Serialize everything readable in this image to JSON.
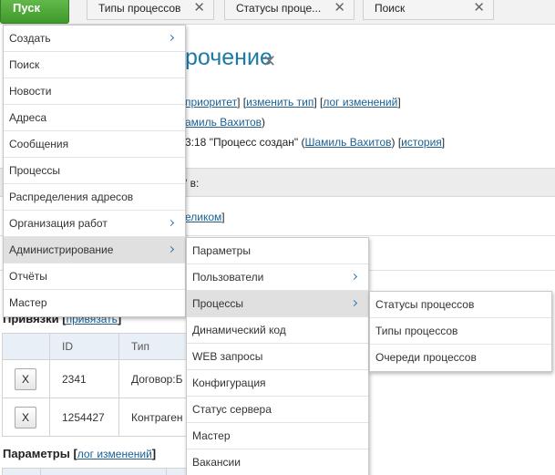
{
  "topbar": {
    "start_label": "Пуск",
    "tabs": [
      {
        "label": "Типы процессов",
        "close": "✕"
      },
      {
        "label": "Статусы проце...",
        "close": "✕"
      },
      {
        "label": "Поиск",
        "close": "✕"
      }
    ]
  },
  "page": {
    "title": "рочение",
    "title_close": "✕",
    "line1": {
      "prefix": "",
      "l1": "приоритет",
      "mid": "] [",
      "l2": "изменить тип",
      "mid2": "] [",
      "l3": "лог изменений",
      "suffix": "]"
    },
    "line2": {
      "link": "амиль Вахитов",
      "suffix": ")"
    },
    "line3": {
      "prefix": "3:18 \"Процесс создан\" (",
      "link": "Шамиль Вахитов",
      "mid": ") [",
      "link2": "история",
      "suffix": "]"
    },
    "bar_text": "\" в:",
    "line4": {
      "link": "еликом",
      "suffix": "]"
    },
    "bindings": {
      "title": "Привязки",
      "link": "привязать",
      "columns": [
        "",
        "ID",
        "Тип"
      ],
      "rows": [
        {
          "button": "X",
          "id": "2341",
          "type": "Договор:Б"
        },
        {
          "button": "X",
          "id": "1254427",
          "type": "Контраген"
        }
      ]
    },
    "params": {
      "title": "Параметры",
      "link": "лог изменений"
    }
  },
  "menu_main": {
    "items": [
      {
        "label": "Создать",
        "submenu": true
      },
      {
        "label": "Поиск",
        "submenu": false
      },
      {
        "label": "Новости",
        "submenu": false
      },
      {
        "label": "Адреса",
        "submenu": false
      },
      {
        "label": "Сообщения",
        "submenu": false
      },
      {
        "label": "Процессы",
        "submenu": false
      },
      {
        "label": "Распределения адресов",
        "submenu": false
      },
      {
        "label": "Организация работ",
        "submenu": true
      },
      {
        "label": "Администрирование",
        "submenu": true,
        "active": true
      },
      {
        "label": "Отчёты",
        "submenu": false
      },
      {
        "label": "Мастер",
        "submenu": false
      }
    ]
  },
  "menu_admin": {
    "items": [
      {
        "label": "Параметры",
        "submenu": false
      },
      {
        "label": "Пользователи",
        "submenu": true
      },
      {
        "label": "Процессы",
        "submenu": true,
        "active": true
      },
      {
        "label": "Динамический код",
        "submenu": false
      },
      {
        "label": "WEB запросы",
        "submenu": false
      },
      {
        "label": "Конфигурация",
        "submenu": false
      },
      {
        "label": "Статус сервера",
        "submenu": false
      },
      {
        "label": "Мастер",
        "submenu": false
      },
      {
        "label": "Вакансии",
        "submenu": false
      }
    ]
  },
  "menu_processes": {
    "items": [
      {
        "label": "Статусы процессов"
      },
      {
        "label": "Типы процессов"
      },
      {
        "label": "Очереди процессов"
      }
    ]
  },
  "colors": {
    "start_button": "#4caa35",
    "link": "#1b5e8f",
    "title": "#1b7aa8",
    "chevron": "#2d77b5",
    "active_item": "#e0e0e0"
  }
}
